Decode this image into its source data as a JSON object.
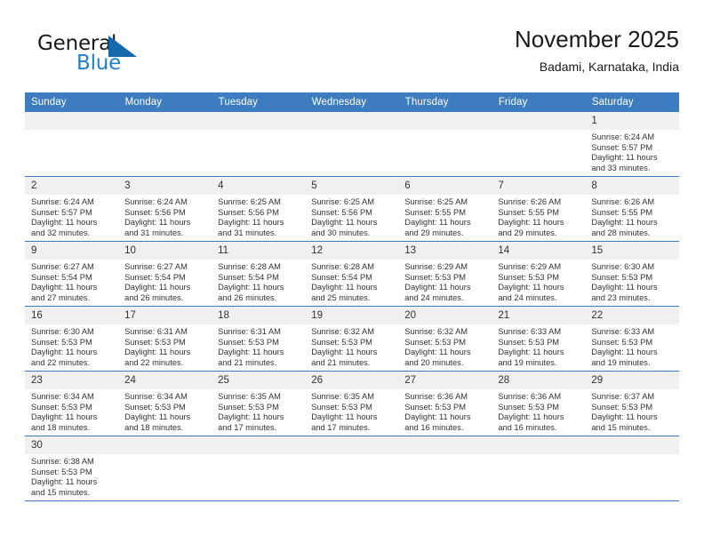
{
  "brand": {
    "name_part1": "General",
    "name_part2": "Blue",
    "mark_icon": "blue-triangle-logo-icon",
    "accent_color": "#1f7fc4"
  },
  "header": {
    "title": "November 2025",
    "subtitle": "Badami, Karnataka, India"
  },
  "theme": {
    "header_blue": "#3c7cbf",
    "daynum_background": "#f0f0f0",
    "text_color": "#333333"
  },
  "weekday_headers": [
    "Sunday",
    "Monday",
    "Tuesday",
    "Wednesday",
    "Thursday",
    "Friday",
    "Saturday"
  ],
  "labels": {
    "sunrise_prefix": "Sunrise:",
    "sunset_prefix": "Sunset:",
    "daylight_prefix": "Daylight:"
  },
  "weeks": [
    [
      {
        "day": "",
        "blank": true
      },
      {
        "day": "",
        "blank": true
      },
      {
        "day": "",
        "blank": true
      },
      {
        "day": "",
        "blank": true
      },
      {
        "day": "",
        "blank": true
      },
      {
        "day": "",
        "blank": true
      },
      {
        "day": "1",
        "sunrise": "Sunrise: 6:24 AM",
        "sunset": "Sunset: 5:57 PM",
        "daylight_line1": "Daylight: 11 hours",
        "daylight_line2": "and 33 minutes."
      }
    ],
    [
      {
        "day": "2",
        "sunrise": "Sunrise: 6:24 AM",
        "sunset": "Sunset: 5:57 PM",
        "daylight_line1": "Daylight: 11 hours",
        "daylight_line2": "and 32 minutes."
      },
      {
        "day": "3",
        "sunrise": "Sunrise: 6:24 AM",
        "sunset": "Sunset: 5:56 PM",
        "daylight_line1": "Daylight: 11 hours",
        "daylight_line2": "and 31 minutes."
      },
      {
        "day": "4",
        "sunrise": "Sunrise: 6:25 AM",
        "sunset": "Sunset: 5:56 PM",
        "daylight_line1": "Daylight: 11 hours",
        "daylight_line2": "and 31 minutes."
      },
      {
        "day": "5",
        "sunrise": "Sunrise: 6:25 AM",
        "sunset": "Sunset: 5:56 PM",
        "daylight_line1": "Daylight: 11 hours",
        "daylight_line2": "and 30 minutes."
      },
      {
        "day": "6",
        "sunrise": "Sunrise: 6:25 AM",
        "sunset": "Sunset: 5:55 PM",
        "daylight_line1": "Daylight: 11 hours",
        "daylight_line2": "and 29 minutes."
      },
      {
        "day": "7",
        "sunrise": "Sunrise: 6:26 AM",
        "sunset": "Sunset: 5:55 PM",
        "daylight_line1": "Daylight: 11 hours",
        "daylight_line2": "and 29 minutes."
      },
      {
        "day": "8",
        "sunrise": "Sunrise: 6:26 AM",
        "sunset": "Sunset: 5:55 PM",
        "daylight_line1": "Daylight: 11 hours",
        "daylight_line2": "and 28 minutes."
      }
    ],
    [
      {
        "day": "9",
        "sunrise": "Sunrise: 6:27 AM",
        "sunset": "Sunset: 5:54 PM",
        "daylight_line1": "Daylight: 11 hours",
        "daylight_line2": "and 27 minutes."
      },
      {
        "day": "10",
        "sunrise": "Sunrise: 6:27 AM",
        "sunset": "Sunset: 5:54 PM",
        "daylight_line1": "Daylight: 11 hours",
        "daylight_line2": "and 26 minutes."
      },
      {
        "day": "11",
        "sunrise": "Sunrise: 6:28 AM",
        "sunset": "Sunset: 5:54 PM",
        "daylight_line1": "Daylight: 11 hours",
        "daylight_line2": "and 26 minutes."
      },
      {
        "day": "12",
        "sunrise": "Sunrise: 6:28 AM",
        "sunset": "Sunset: 5:54 PM",
        "daylight_line1": "Daylight: 11 hours",
        "daylight_line2": "and 25 minutes."
      },
      {
        "day": "13",
        "sunrise": "Sunrise: 6:29 AM",
        "sunset": "Sunset: 5:53 PM",
        "daylight_line1": "Daylight: 11 hours",
        "daylight_line2": "and 24 minutes."
      },
      {
        "day": "14",
        "sunrise": "Sunrise: 6:29 AM",
        "sunset": "Sunset: 5:53 PM",
        "daylight_line1": "Daylight: 11 hours",
        "daylight_line2": "and 24 minutes."
      },
      {
        "day": "15",
        "sunrise": "Sunrise: 6:30 AM",
        "sunset": "Sunset: 5:53 PM",
        "daylight_line1": "Daylight: 11 hours",
        "daylight_line2": "and 23 minutes."
      }
    ],
    [
      {
        "day": "16",
        "sunrise": "Sunrise: 6:30 AM",
        "sunset": "Sunset: 5:53 PM",
        "daylight_line1": "Daylight: 11 hours",
        "daylight_line2": "and 22 minutes."
      },
      {
        "day": "17",
        "sunrise": "Sunrise: 6:31 AM",
        "sunset": "Sunset: 5:53 PM",
        "daylight_line1": "Daylight: 11 hours",
        "daylight_line2": "and 22 minutes."
      },
      {
        "day": "18",
        "sunrise": "Sunrise: 6:31 AM",
        "sunset": "Sunset: 5:53 PM",
        "daylight_line1": "Daylight: 11 hours",
        "daylight_line2": "and 21 minutes."
      },
      {
        "day": "19",
        "sunrise": "Sunrise: 6:32 AM",
        "sunset": "Sunset: 5:53 PM",
        "daylight_line1": "Daylight: 11 hours",
        "daylight_line2": "and 21 minutes."
      },
      {
        "day": "20",
        "sunrise": "Sunrise: 6:32 AM",
        "sunset": "Sunset: 5:53 PM",
        "daylight_line1": "Daylight: 11 hours",
        "daylight_line2": "and 20 minutes."
      },
      {
        "day": "21",
        "sunrise": "Sunrise: 6:33 AM",
        "sunset": "Sunset: 5:53 PM",
        "daylight_line1": "Daylight: 11 hours",
        "daylight_line2": "and 19 minutes."
      },
      {
        "day": "22",
        "sunrise": "Sunrise: 6:33 AM",
        "sunset": "Sunset: 5:53 PM",
        "daylight_line1": "Daylight: 11 hours",
        "daylight_line2": "and 19 minutes."
      }
    ],
    [
      {
        "day": "23",
        "sunrise": "Sunrise: 6:34 AM",
        "sunset": "Sunset: 5:53 PM",
        "daylight_line1": "Daylight: 11 hours",
        "daylight_line2": "and 18 minutes."
      },
      {
        "day": "24",
        "sunrise": "Sunrise: 6:34 AM",
        "sunset": "Sunset: 5:53 PM",
        "daylight_line1": "Daylight: 11 hours",
        "daylight_line2": "and 18 minutes."
      },
      {
        "day": "25",
        "sunrise": "Sunrise: 6:35 AM",
        "sunset": "Sunset: 5:53 PM",
        "daylight_line1": "Daylight: 11 hours",
        "daylight_line2": "and 17 minutes."
      },
      {
        "day": "26",
        "sunrise": "Sunrise: 6:35 AM",
        "sunset": "Sunset: 5:53 PM",
        "daylight_line1": "Daylight: 11 hours",
        "daylight_line2": "and 17 minutes."
      },
      {
        "day": "27",
        "sunrise": "Sunrise: 6:36 AM",
        "sunset": "Sunset: 5:53 PM",
        "daylight_line1": "Daylight: 11 hours",
        "daylight_line2": "and 16 minutes."
      },
      {
        "day": "28",
        "sunrise": "Sunrise: 6:36 AM",
        "sunset": "Sunset: 5:53 PM",
        "daylight_line1": "Daylight: 11 hours",
        "daylight_line2": "and 16 minutes."
      },
      {
        "day": "29",
        "sunrise": "Sunrise: 6:37 AM",
        "sunset": "Sunset: 5:53 PM",
        "daylight_line1": "Daylight: 11 hours",
        "daylight_line2": "and 15 minutes."
      }
    ],
    [
      {
        "day": "30",
        "sunrise": "Sunrise: 6:38 AM",
        "sunset": "Sunset: 5:53 PM",
        "daylight_line1": "Daylight: 11 hours",
        "daylight_line2": "and 15 minutes."
      },
      {
        "day": "",
        "blank": true
      },
      {
        "day": "",
        "blank": true
      },
      {
        "day": "",
        "blank": true
      },
      {
        "day": "",
        "blank": true
      },
      {
        "day": "",
        "blank": true
      },
      {
        "day": "",
        "blank": true
      }
    ]
  ]
}
